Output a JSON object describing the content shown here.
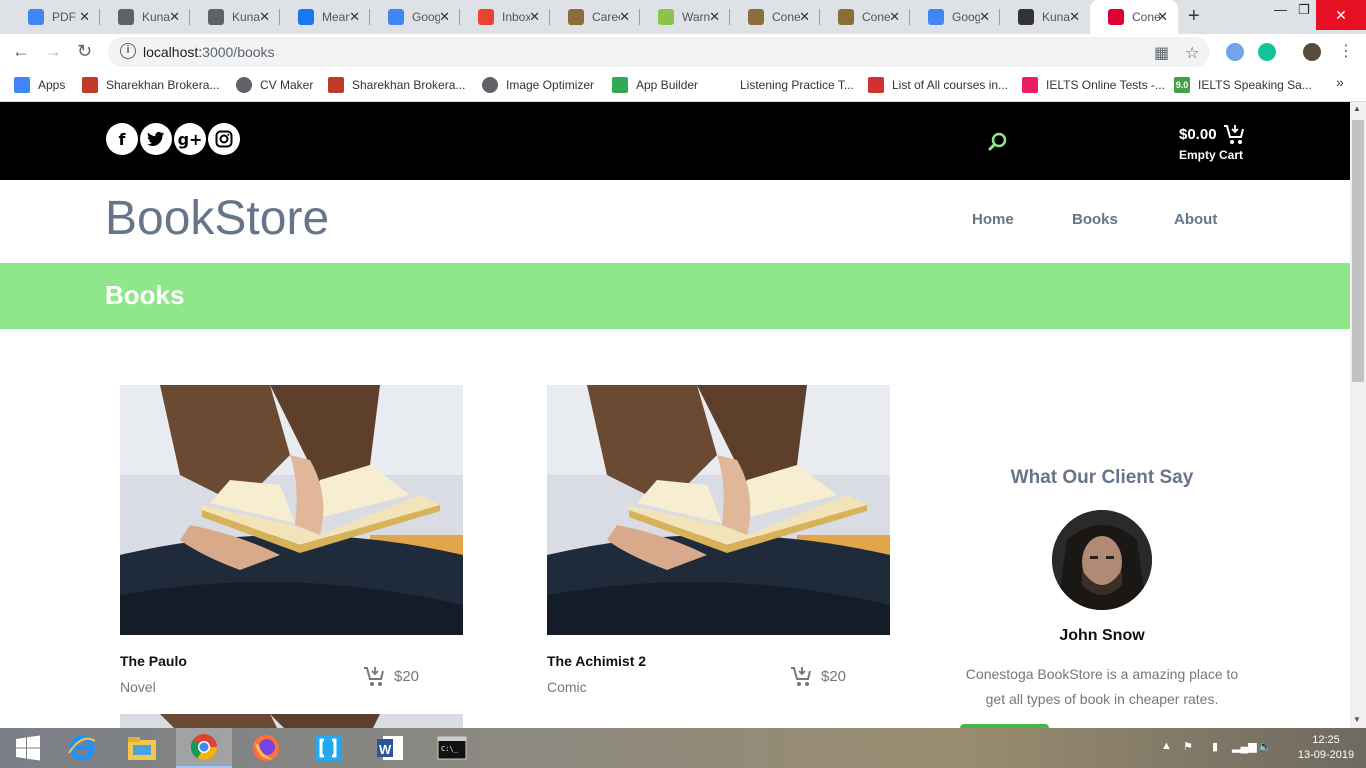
{
  "browser": {
    "tabs": [
      {
        "title": "PDF",
        "icon": "pdf-icon",
        "color": "#4285f4"
      },
      {
        "title": "Kuna",
        "icon": "globe-icon",
        "color": "#5f6368"
      },
      {
        "title": "Kuna",
        "icon": "globe-icon",
        "color": "#5f6368"
      },
      {
        "title": "Mean",
        "icon": "facebook-icon",
        "color": "#1877f2"
      },
      {
        "title": "Goog",
        "icon": "google-translate-icon",
        "color": "#4285f4"
      },
      {
        "title": "Inbox",
        "icon": "gmail-icon",
        "color": "#ea4335"
      },
      {
        "title": "Caree",
        "icon": "conestoga-icon",
        "color": "#8a6d3b"
      },
      {
        "title": "Warn",
        "icon": "my-icon",
        "color": "#8bc34a"
      },
      {
        "title": "Cone",
        "icon": "conestoga-icon",
        "color": "#8a6d3b"
      },
      {
        "title": "Cone",
        "icon": "conestoga-icon",
        "color": "#8a6d3b"
      },
      {
        "title": "Goog",
        "icon": "google-translate-icon",
        "color": "#4285f4"
      },
      {
        "title": "Kuna",
        "icon": "pi-icon",
        "color": "#333333"
      },
      {
        "title": "Cone",
        "icon": "angular-icon",
        "color": "#dd0031",
        "active": true
      }
    ],
    "url_host": "localhost:",
    "url_rest": "3000/books",
    "bookmarks": [
      {
        "label": "Apps",
        "icon": "apps-grid-icon"
      },
      {
        "label": "Sharekhan Brokera...",
        "icon": "sharekhan-icon"
      },
      {
        "label": "CV Maker",
        "icon": "globe-icon"
      },
      {
        "label": "Sharekhan Brokera...",
        "icon": "sharekhan-icon"
      },
      {
        "label": "Image Optimizer",
        "icon": "globe-icon"
      },
      {
        "label": "App Builder",
        "icon": "app-builder-icon"
      },
      {
        "label": "Listening Practice T...",
        "icon": "blank-icon"
      },
      {
        "label": "List of All courses in...",
        "icon": "courses-icon"
      },
      {
        "label": "IELTS Online Tests -...",
        "icon": "ielts-icon"
      },
      {
        "label": "IELTS Speaking Sa...",
        "icon": "nine-icon"
      }
    ]
  },
  "site": {
    "social": [
      {
        "icon": "facebook-icon",
        "glyph": "f"
      },
      {
        "icon": "twitter-icon",
        "glyph": "t"
      },
      {
        "icon": "google-plus-icon",
        "glyph": "g+"
      },
      {
        "icon": "instagram-icon",
        "glyph": ""
      }
    ],
    "cart_total": "$0.00",
    "cart_status": "Empty Cart",
    "logo": "BookStore",
    "menu": [
      "Home",
      "Books",
      "About"
    ],
    "banner_title": "Books",
    "books": [
      {
        "title": "The Paulo",
        "genre": "Novel",
        "price": "$20"
      },
      {
        "title": "The Achimist 2",
        "genre": "Comic",
        "price": "$20"
      }
    ],
    "testimonial": {
      "heading": "What Our Client Say",
      "name": "John Snow",
      "quote": "Conestoga BookStore is a amazing place to get all types of book in cheaper rates."
    },
    "accent": "#90e78b",
    "text_muted": "#67758a"
  },
  "taskbar": {
    "apps": [
      "windows-start-icon",
      "internet-explorer-icon",
      "file-explorer-icon",
      "chrome-icon",
      "firefox-icon",
      "brackets-icon",
      "word-icon",
      "cmd-icon"
    ],
    "time": "12:25",
    "date": "13-09-2019"
  }
}
